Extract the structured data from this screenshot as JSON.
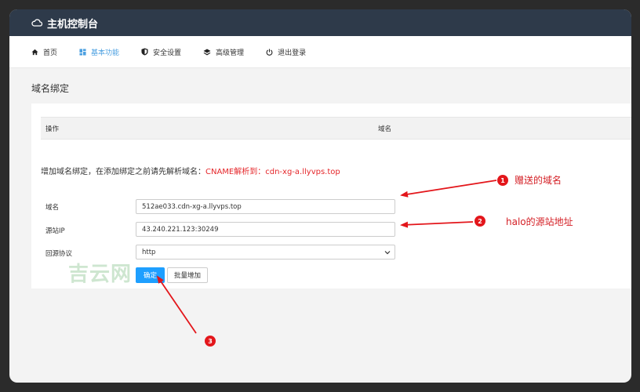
{
  "app": {
    "title": "主机控制台"
  },
  "nav": {
    "items": [
      {
        "label": "首页",
        "icon": "home-icon",
        "active": false
      },
      {
        "label": "基本功能",
        "icon": "grid-icon",
        "active": true
      },
      {
        "label": "安全设置",
        "icon": "shield-icon",
        "active": false
      },
      {
        "label": "高级管理",
        "icon": "layers-icon",
        "active": false
      },
      {
        "label": "退出登录",
        "icon": "power-icon",
        "active": false
      }
    ]
  },
  "page": {
    "title": "域名绑定"
  },
  "table": {
    "columns": [
      "操作",
      "域名"
    ]
  },
  "hint": {
    "text": "增加域名绑定，在添加绑定之前请先解析域名：",
    "cname": "CNAME解析到：cdn-xg-a.llyvps.top"
  },
  "form": {
    "domain": {
      "label": "域名",
      "value": "512ae033.cdn-xg-a.llyvps.top"
    },
    "source_ip": {
      "label": "源站IP",
      "value": "43.240.221.123:30249"
    },
    "protocol": {
      "label": "回源协议",
      "value": "http"
    }
  },
  "buttons": {
    "ok": "确定",
    "batch": "批量增加"
  },
  "watermark": "吉云网",
  "annotations": {
    "n1": "1",
    "t1": "赠送的域名",
    "n2": "2",
    "t2": "halo的源站地址",
    "n3": "3"
  },
  "colors": {
    "accent": "#1e9fff",
    "annotation": "#e3161b",
    "titlebar": "#2e3a4a"
  }
}
